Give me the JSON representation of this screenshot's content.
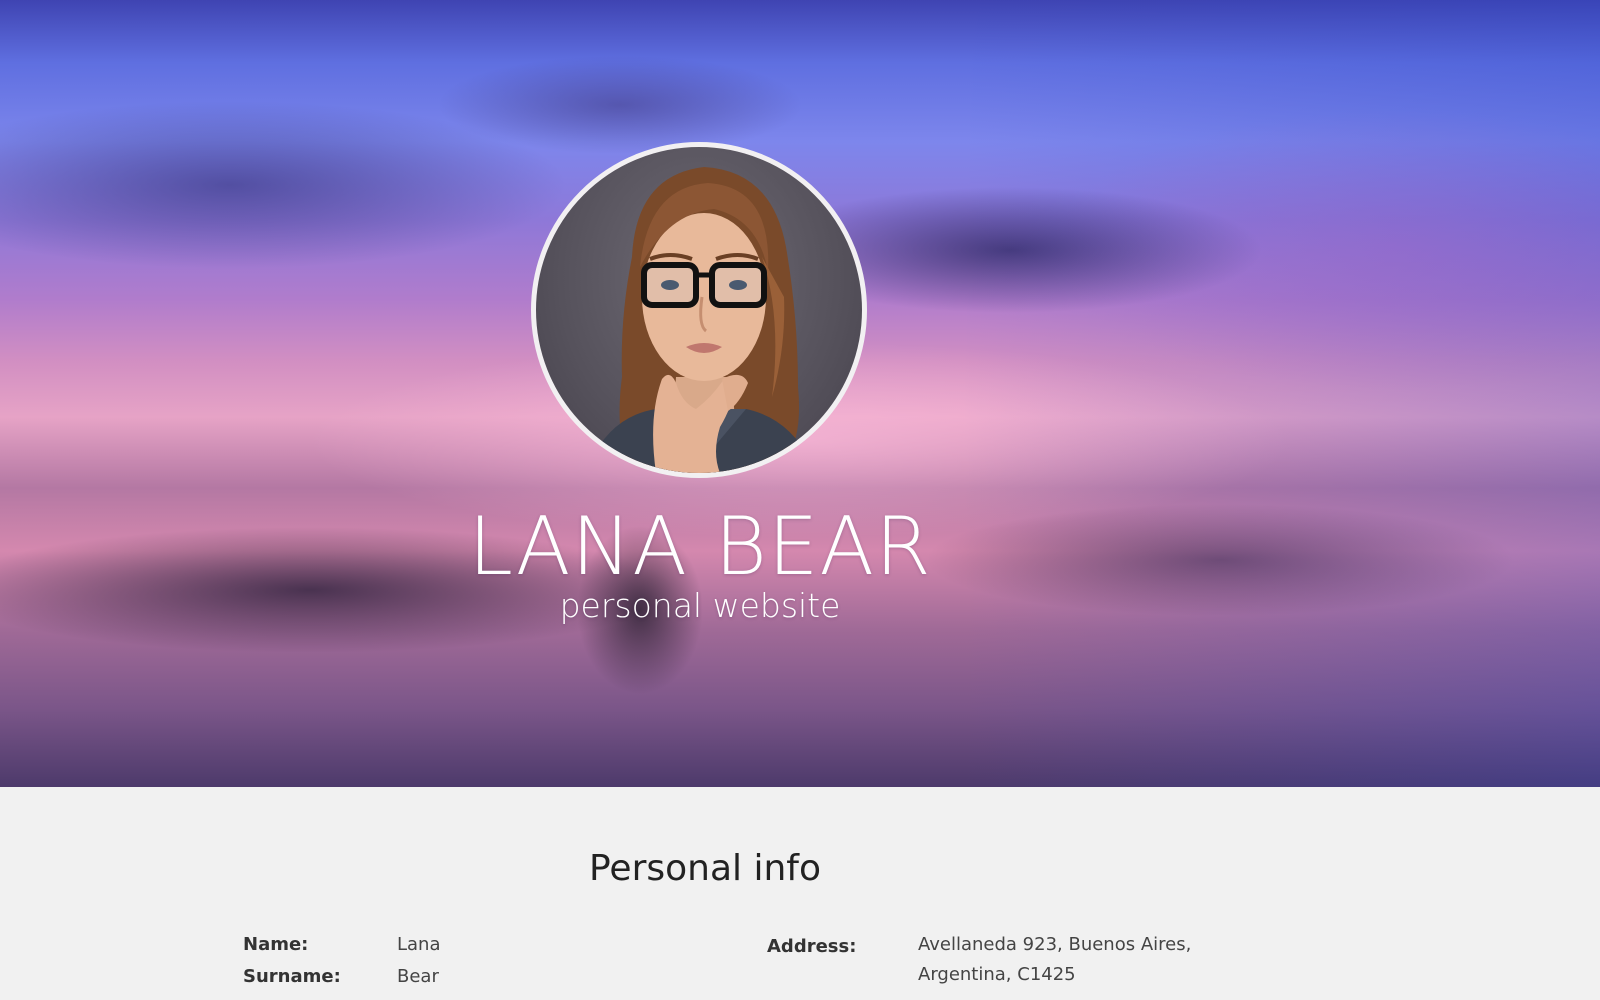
{
  "hero": {
    "name": "LANA BEAR",
    "tagline": "personal website"
  },
  "personal_info": {
    "heading": "Personal info",
    "fields": [
      {
        "label": "Name:",
        "value": "Lana"
      },
      {
        "label": "Surname:",
        "value": "Bear"
      }
    ],
    "address": {
      "label": "Address:",
      "line1": "Avellaneda 923, Buenos Aires,",
      "line2": "Argentina, C1425"
    }
  },
  "colors": {
    "section_background": "#f1f1f1",
    "heading_text": "#222222",
    "hero_text": "#ffffff",
    "avatar_border": "#f2f0f2"
  }
}
